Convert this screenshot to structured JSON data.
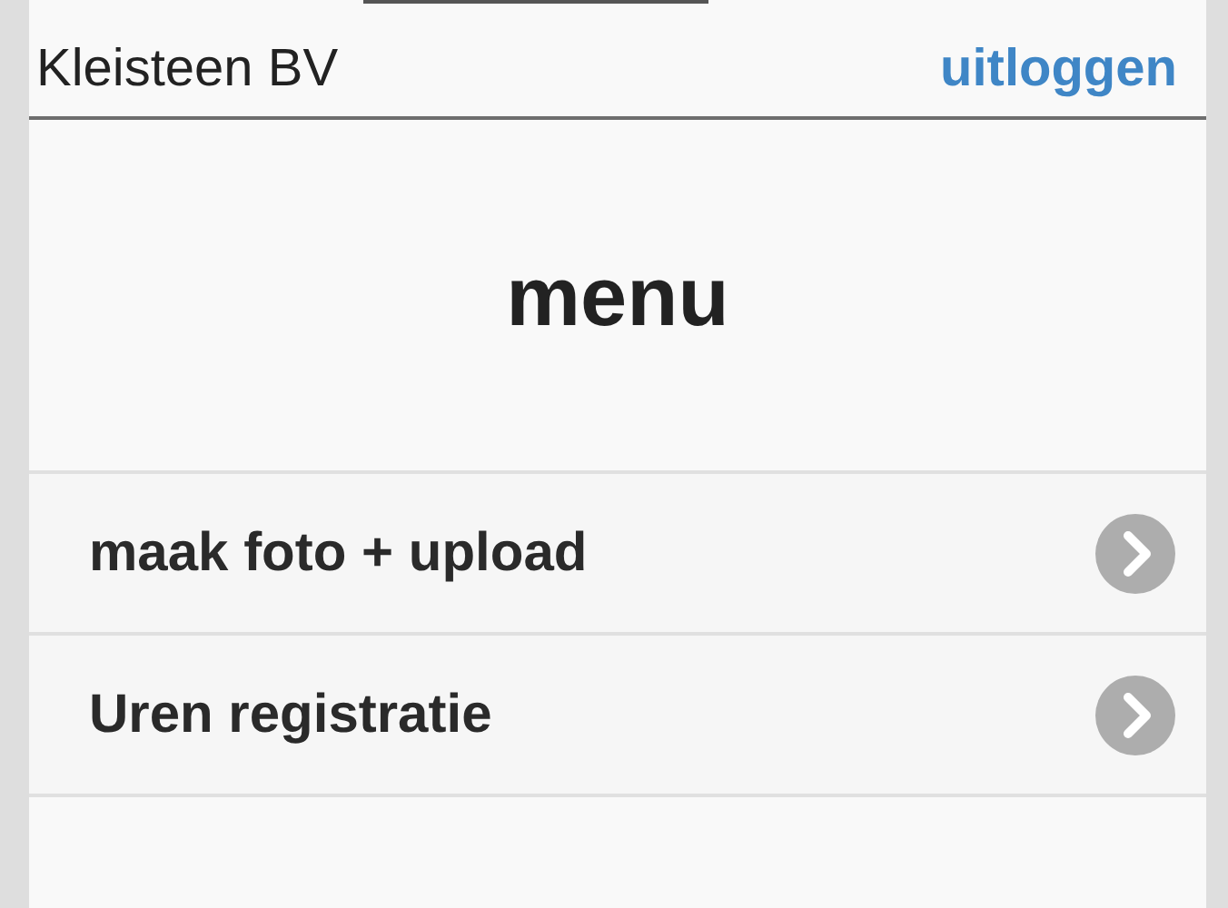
{
  "header": {
    "company": "Kleisteen BV",
    "logout_link": "uitloggen"
  },
  "title": "menu",
  "menu_items": [
    {
      "label": "maak foto + upload"
    },
    {
      "label": "Uren registratie"
    }
  ]
}
